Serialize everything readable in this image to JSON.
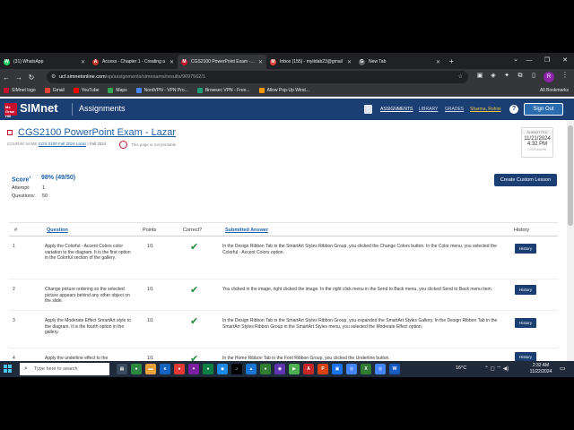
{
  "browser": {
    "tabs": [
      {
        "label": "(31) WhatsApp",
        "color": "#25d366",
        "glyph": "W"
      },
      {
        "label": "Access - Chapter 1 - Creating a",
        "color": "#c0392b",
        "glyph": "A"
      },
      {
        "label": "CGS2100 PowerPoint Exam - La",
        "color": "#c8102e",
        "glyph": "M",
        "active": true
      },
      {
        "label": "Inbox (155) - myitdab23@gmail",
        "color": "#ea4335",
        "glyph": "M"
      },
      {
        "label": "New Tab",
        "color": "#5f6368",
        "glyph": "G"
      }
    ],
    "new_tab": "+",
    "url_host": "ucf.simnetonline.com",
    "url_path": "/sp/assignments/simexams/results/9097562/1",
    "bookmarks": [
      {
        "label": "SIMnet logo",
        "color": "#c8102e"
      },
      {
        "label": "Gmail",
        "color": "#ea4335"
      },
      {
        "label": "YouTube",
        "color": "#ff0000"
      },
      {
        "label": "Maps",
        "color": "#34a853"
      },
      {
        "label": "NordVPN - VPN Pro...",
        "color": "#4687ff"
      },
      {
        "label": "Browsec VPN - Free...",
        "color": "#1b9e77"
      },
      {
        "label": "Allow Pop-Up Wind...",
        "color": "#ff9800"
      }
    ],
    "all_bookmarks": "All Bookmarks"
  },
  "header": {
    "logo_box": "Mc Graw Hill",
    "logo": "SIMnet",
    "title": "Assignments",
    "links": [
      "ASSIGNMENTS",
      "LIBRARY",
      "GRADES"
    ],
    "user": "Sharma, Rohini",
    "help": "?",
    "sign_out": "Sign Out"
  },
  "exam": {
    "title": "CGS2100 PowerPoint Exam - Lazar",
    "course_label": "COURSE NAME",
    "course": "CGS 2100 Fall 2024 Lazar",
    "term": "Fall 2024",
    "not_printable": "This page is not printable",
    "submitted_label": "SUBMITTED",
    "submitted_date": "11/21/2024",
    "submitted_time": "4:32 PM",
    "submitted_user": "US/Eastern"
  },
  "score": {
    "label": "Score",
    "sup": "1",
    "value": "98% (49/50)",
    "attempt_label": "Attempt:",
    "attempt": "1",
    "questions_label": "Questions:",
    "questions": "50",
    "custom_lesson": "Create Custom Lesson"
  },
  "table": {
    "headers": {
      "num": "#",
      "question": "Question",
      "points": "Points",
      "correct": "Correct?",
      "answer": "Submitted Answer",
      "history": "History"
    },
    "rows": [
      {
        "num": "1",
        "question": "Apply the Colorful - Accent Colors color variation to the diagram. It is the first option in the Colorful section of the gallery.",
        "points": "1/1",
        "answer": "In the Design Ribbon Tab in the SmartArt Styles Ribbon Group, you clicked the Change Colors button. In the Color menu, you selected the Colorful - Accent Colors option.",
        "history": "History"
      },
      {
        "num": "2",
        "question": "Change picture ordering so the selected picture appears behind any other object on the slide.",
        "points": "1/1",
        "answer": "You clicked in the image, right clicked the image. In the right click menu in the Send to Back menu, you clicked Send to Back menu item.",
        "history": "History"
      },
      {
        "num": "3",
        "question": "Apply the Moderate Effect SmartArt style to the diagram. It is the fourth option in the gallery.",
        "points": "1/1",
        "answer": "In the Design Ribbon Tab in the SmartArt Styles Ribbon Group, you expanded the SmartArt Styles Gallery. In the Design Ribbon Tab in the SmartArt Styles Ribbon Group in the SmartArt Styles menu, you selected the Moderate Effect option.",
        "history": "History"
      },
      {
        "num": "4",
        "question": "Apply the underline effect to the",
        "points": "1/1",
        "answer": "In the Home Ribbon Tab in the Font Ribbon Group, you clicked the Underline button.",
        "history": "History"
      }
    ]
  },
  "taskbar": {
    "search_placeholder": "Type here to search",
    "weather": "16°C",
    "time": "2:32 AM",
    "date": "11/22/2024"
  }
}
